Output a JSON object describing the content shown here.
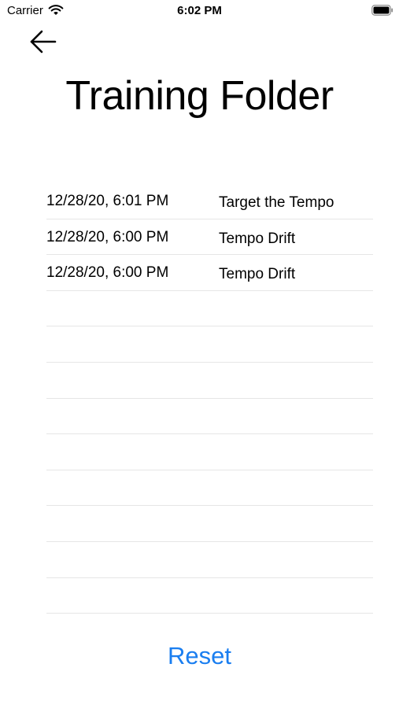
{
  "status_bar": {
    "carrier": "Carrier",
    "time": "6:02 PM",
    "wifi_icon": "wifi-icon",
    "battery_icon": "battery-full-icon"
  },
  "nav": {
    "back_icon": "arrow-left-icon"
  },
  "page": {
    "title": "Training Folder"
  },
  "records": [
    {
      "date": "12/28/20, 6:01 PM",
      "name": "Target the Tempo"
    },
    {
      "date": "12/28/20, 6:00 PM",
      "name": "Tempo Drift"
    },
    {
      "date": "12/28/20, 6:00 PM",
      "name": "Tempo Drift"
    },
    {
      "date": "",
      "name": ""
    },
    {
      "date": "",
      "name": ""
    },
    {
      "date": "",
      "name": ""
    },
    {
      "date": "",
      "name": ""
    },
    {
      "date": "",
      "name": ""
    },
    {
      "date": "",
      "name": ""
    },
    {
      "date": "",
      "name": ""
    },
    {
      "date": "",
      "name": ""
    },
    {
      "date": "",
      "name": ""
    }
  ],
  "actions": {
    "reset_label": "Reset"
  },
  "colors": {
    "accent": "#1a7ef0",
    "separator": "#e6e6e6"
  }
}
